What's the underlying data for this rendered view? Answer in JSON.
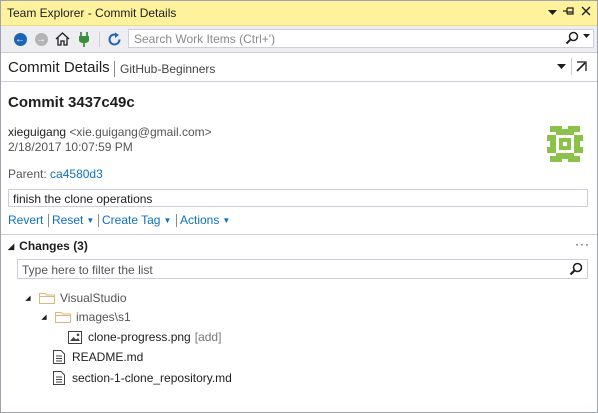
{
  "window": {
    "title": "Team Explorer - Commit Details"
  },
  "toolbar": {
    "search_placeholder": "Search Work Items (Ctrl+')"
  },
  "header": {
    "title": "Commit Details",
    "repo": "GitHub-Beginners"
  },
  "commit": {
    "title": "Commit 3437c49c",
    "author": "xieguigang",
    "email": "<xie.guigang@gmail.com>",
    "date": "2/18/2017 10:07:59 PM",
    "parent_label": "Parent:",
    "parent_hash": "ca4580d3",
    "message": "finish the clone operations"
  },
  "actions": {
    "revert": "Revert",
    "reset": "Reset",
    "create_tag": "Create Tag",
    "actions": "Actions"
  },
  "changes": {
    "label": "Changes",
    "count": "(3)",
    "filter_placeholder": "Type here to filter the list",
    "tree": [
      {
        "label": "VisualStudio",
        "kind": "folder"
      },
      {
        "label": "images\\s1",
        "kind": "folder"
      },
      {
        "label": "clone-progress.png",
        "kind": "image",
        "tag": "[add]"
      },
      {
        "label": "README.md",
        "kind": "file"
      },
      {
        "label": "section-1-clone_repository.md",
        "kind": "file"
      }
    ]
  },
  "colors": {
    "titlebar": "#fff29d",
    "link": "#0e70c0",
    "avatar": "#8bc34a"
  },
  "icons": {
    "back": "back-arrow-icon",
    "forward": "forward-arrow-icon",
    "home": "home-icon",
    "connect": "plug-icon",
    "refresh": "refresh-icon",
    "search": "search-icon"
  }
}
